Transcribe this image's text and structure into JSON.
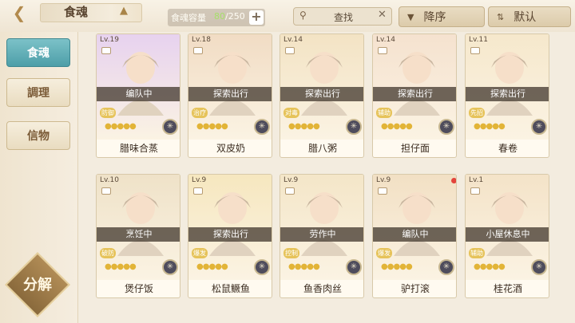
{
  "header": {
    "back_icon": "back-arrow-icon",
    "title": "食魂",
    "capacity_label": "食魂容量",
    "capacity_current": "80",
    "capacity_total": "/250",
    "search_text": "查找",
    "sort_order_label": "降序",
    "sort_mode_label": "默认"
  },
  "sidebar": {
    "tabs": [
      {
        "label": "食魂",
        "active": true
      },
      {
        "label": "調理",
        "active": false
      },
      {
        "label": "信物",
        "active": false
      }
    ],
    "decompose_label": "分解"
  },
  "cards": [
    {
      "level": "Lv.19",
      "status": "编队中",
      "role": "防御",
      "stars": 5,
      "name": "腊味合蒸",
      "bg": "#e7d2ef"
    },
    {
      "level": "Lv.18",
      "status": "探索出行",
      "role": "治疗",
      "stars": 5,
      "name": "双皮奶",
      "bg": "#f1dcc4"
    },
    {
      "level": "Lv.14",
      "status": "探索出行",
      "role": "对毒",
      "stars": 5,
      "name": "腊八粥",
      "bg": "#f3e3c4"
    },
    {
      "level": "Lv.14",
      "status": "探索出行",
      "role": "辅助",
      "stars": 5,
      "name": "担仔面",
      "bg": "#f5e2cf"
    },
    {
      "level": "Lv.11",
      "status": "探索出行",
      "role": "先招",
      "stars": 5,
      "name": "春卷",
      "bg": "#f6e8cc"
    },
    {
      "level": "Lv.10",
      "status": "烹饪中",
      "role": "破防",
      "stars": 5,
      "name": "煲仔饭",
      "bg": "#efe2c8"
    },
    {
      "level": "Lv.9",
      "status": "探索出行",
      "role": "爆发",
      "stars": 5,
      "name": "松鼠鳜鱼",
      "bg": "#f6e7bf"
    },
    {
      "level": "Lv.9",
      "status": "劳作中",
      "role": "控制",
      "stars": 5,
      "name": "鱼香肉丝",
      "bg": "#f4e6c8"
    },
    {
      "level": "Lv.9",
      "status": "编队中",
      "role": "爆发",
      "stars": 5,
      "name": "驴打滚",
      "bg": "#f2e0c4",
      "notice": true
    },
    {
      "level": "Lv.1",
      "status": "小屋休息中",
      "role": "辅助",
      "stars": 5,
      "name": "桂花酒",
      "bg": "#f4e3c8"
    }
  ]
}
